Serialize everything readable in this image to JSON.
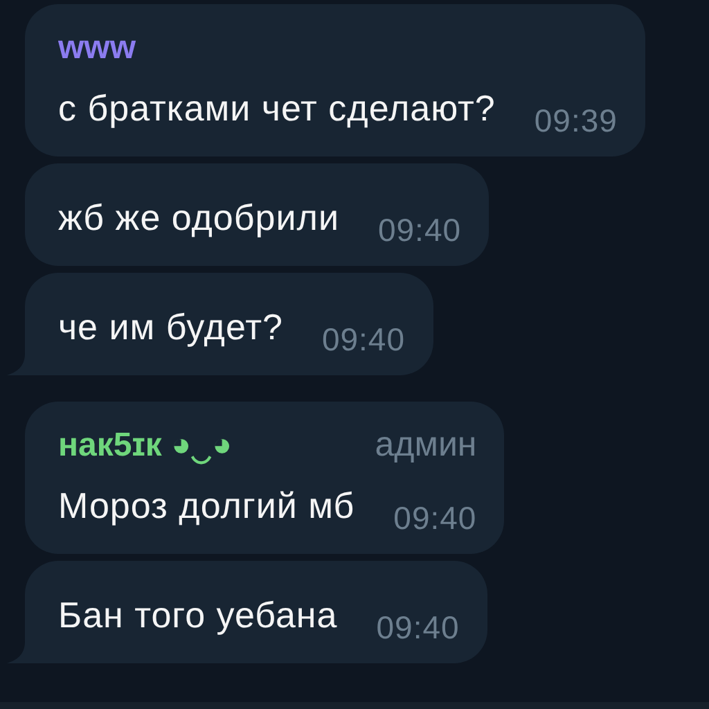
{
  "messages": [
    {
      "sender": "www",
      "color": "#8b7cf0",
      "text": "с братками чет сделают?",
      "time": "09:39",
      "tail": false
    },
    {
      "text": "жб же одобрили",
      "time": "09:40",
      "tail": false
    },
    {
      "text": "че им будет?",
      "time": "09:40",
      "tail": true
    },
    {
      "sender": "нак5ɪк ◕‿◕",
      "color": "#6fd67c",
      "role": "админ",
      "text": "Мороз долгий мб",
      "time": "09:40",
      "tail": false
    },
    {
      "text": "Бан того уебана",
      "time": "09:40",
      "tail": true
    }
  ]
}
